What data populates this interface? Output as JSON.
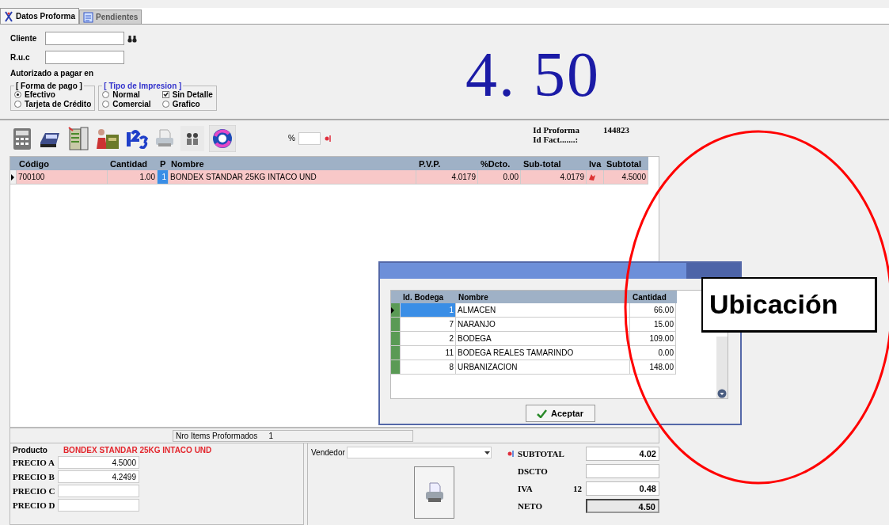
{
  "tabs": [
    {
      "label": "Datos Proforma",
      "selected": true
    },
    {
      "label": "Pendientes",
      "selected": false
    }
  ],
  "client": {
    "cliente_label": "Cliente",
    "ruc_label": "R.u.c",
    "authorized_label": "Autorizado a pagar en"
  },
  "payment_group": {
    "title": "[ Forma de pago ]",
    "options": [
      {
        "label": "Efectivo",
        "selected": true
      },
      {
        "label": "Tarjeta de Crédito",
        "selected": false
      }
    ]
  },
  "print_group": {
    "title": "[ Tipo de Impresion ]",
    "options": [
      {
        "label": "Normal",
        "kind": "radio",
        "selected": false
      },
      {
        "label": "Sin Detalle",
        "kind": "checkbox",
        "checked": true
      },
      {
        "label": "Comercial",
        "kind": "radio",
        "selected": false
      },
      {
        "label": "Grafico",
        "kind": "radio",
        "selected": false
      }
    ]
  },
  "total_display": "4. 50",
  "toolbar": {
    "percent_label": "%"
  },
  "ids": [
    {
      "label": "Id Proforma",
      "value": "144823"
    },
    {
      "label": "Id Fact.......:"
    }
  ],
  "grid": {
    "columns": [
      "Código",
      "Cantidad",
      "P",
      "Nombre",
      "P.V.P.",
      "%Dcto.",
      "Sub-total",
      "Iva",
      "Subtotal"
    ],
    "rows": [
      {
        "selected": true,
        "code": "700100",
        "quantity": "1.00",
        "p": "1",
        "name": "BONDEX STANDAR 25KG INTACO  UND",
        "pvp": "4.0179",
        "discount": "0.00",
        "subtotal": "4.0179",
        "total": "4.5000"
      }
    ]
  },
  "status_bar": {
    "label": "Nro Items Proformados",
    "count": "1"
  },
  "product": {
    "label": "Producto",
    "name": "BONDEX STANDAR 25KG INTACO  UND",
    "prices": [
      {
        "label": "PRECIO A",
        "value": "4.5000"
      },
      {
        "label": "PRECIO B",
        "value": "4.2499"
      },
      {
        "label": "PRECIO C"
      },
      {
        "label": "PRECIO D"
      }
    ]
  },
  "vendedor": {
    "label": "Vendedor"
  },
  "totals": [
    {
      "label": "SUBTOTAL",
      "value": "4.02"
    },
    {
      "label": "DSCTO"
    },
    {
      "label": "IVA",
      "rate": "12",
      "value": "0.48"
    },
    {
      "label": "NETO",
      "value": "4.50"
    }
  ],
  "dialog": {
    "columns": [
      "Id. Bodega",
      "Nombre",
      "Cantidad"
    ],
    "rows": [
      {
        "id": "1",
        "name": "ALMACEN",
        "quantity": "66.00",
        "selected": true
      },
      {
        "id": "7",
        "name": "NARANJO",
        "quantity": "15.00",
        "selected": false
      },
      {
        "id": "2",
        "name": "BODEGA",
        "quantity": "109.00",
        "selected": false
      },
      {
        "id": "11",
        "name": "BODEGA REALES TAMARINDO",
        "quantity": "0.00",
        "selected": false
      },
      {
        "id": "8",
        "name": "URBANIZACION",
        "quantity": "148.00",
        "selected": false
      }
    ],
    "button": "Aceptar"
  },
  "annotation": {
    "text": "Ubicación"
  }
}
